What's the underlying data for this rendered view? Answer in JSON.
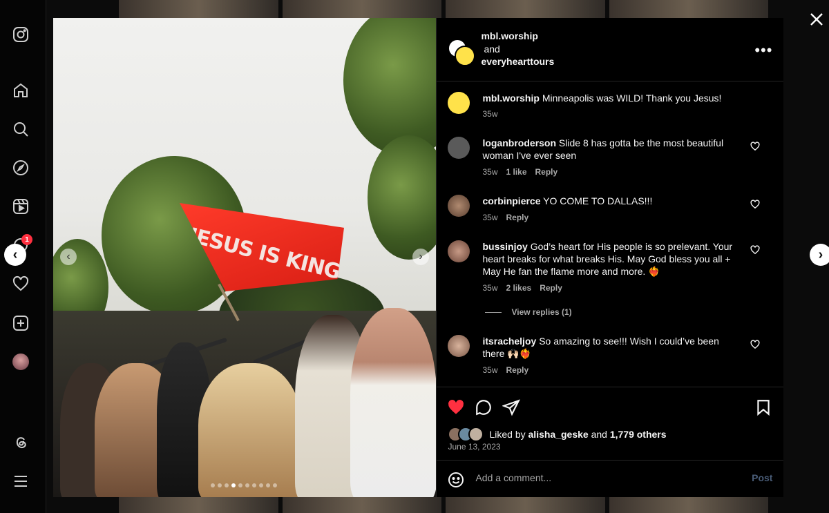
{
  "nav": {
    "badge_count": "1",
    "icons": [
      "instagram-icon",
      "home-icon",
      "search-icon",
      "explore-icon",
      "reels-icon",
      "messages-icon",
      "notifications-icon",
      "create-icon",
      "profile-avatar",
      "threads-icon",
      "menu-icon"
    ]
  },
  "post": {
    "flag_text": "JESUS IS KING",
    "slide_count": 10,
    "active_slide": 3,
    "header": {
      "user1": "mbl.worship",
      "and_text": "and",
      "user2": "everyhearttours"
    },
    "caption": {
      "username": "mbl.worship",
      "text": "Minneapolis was WILD! Thank you Jesus!",
      "time": "35w"
    },
    "comments": [
      {
        "username": "loganbroderson",
        "text": "Slide 8 has gotta be the most beautiful woman I've ever seen",
        "time": "35w",
        "likes": "1 like",
        "reply": "Reply"
      },
      {
        "username": "corbinpierce",
        "text": "YO COME TO DALLAS!!!",
        "time": "35w",
        "reply": "Reply"
      },
      {
        "username": "bussinjoy",
        "text": "God’s heart for His people is so prelevant. Your heart breaks for what breaks His. May God bless you all + May He fan the flame more and more. ❤️‍🔥",
        "time": "35w",
        "likes": "2 likes",
        "reply": "Reply",
        "view_replies": "View replies (1)"
      },
      {
        "username": "itsracheljoy",
        "text": "So amazing to see!!! Wish I could’ve been there 🙌🏻❤️‍🔥",
        "time": "35w",
        "reply": "Reply"
      }
    ],
    "liked_by_prefix": "Liked by",
    "liked_by_user": "alisha_geske",
    "liked_by_and": "and",
    "liked_by_others": "1,779 others",
    "date": "June 13, 2023",
    "add_comment_placeholder": "Add a comment...",
    "post_button": "Post"
  },
  "colors": {
    "like_red": "#ff3040",
    "post_button": "#4a5d78",
    "meta_gray": "#a8a8a8"
  }
}
